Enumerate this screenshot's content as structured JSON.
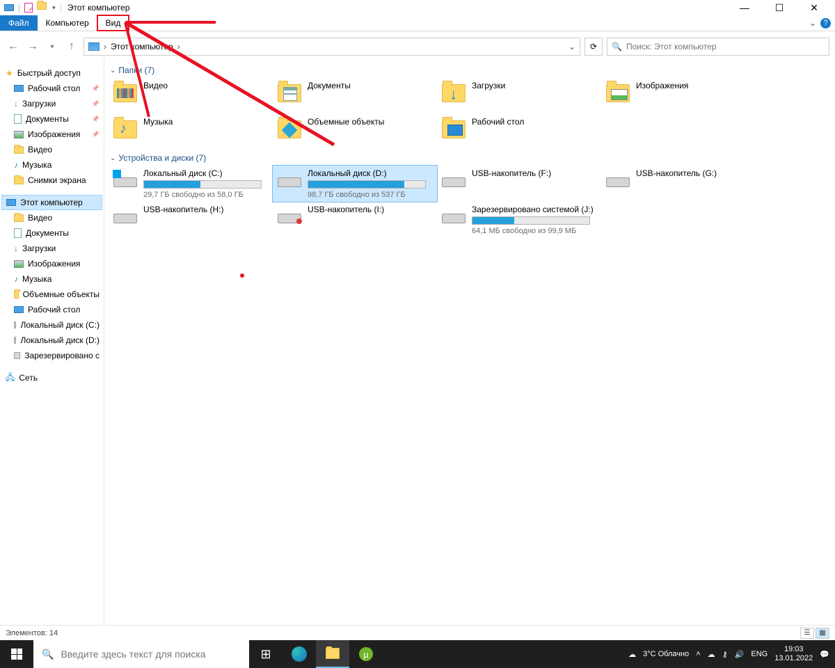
{
  "window": {
    "title": "Этот компьютер"
  },
  "ribbon": {
    "file": "Файл",
    "computer": "Компьютер",
    "view": "Вид"
  },
  "breadcrumb": {
    "label": "Этот компьютер"
  },
  "search": {
    "placeholder": "Поиск: Этот компьютер"
  },
  "sidebar": {
    "quick": "Быстрый доступ",
    "items": [
      {
        "label": "Рабочий стол"
      },
      {
        "label": "Загрузки"
      },
      {
        "label": "Документы"
      },
      {
        "label": "Изображения"
      },
      {
        "label": "Видео"
      },
      {
        "label": "Музыка"
      },
      {
        "label": "Снимки экрана"
      }
    ],
    "thispc": "Этот компьютер",
    "pc_items": [
      {
        "label": "Видео"
      },
      {
        "label": "Документы"
      },
      {
        "label": "Загрузки"
      },
      {
        "label": "Изображения"
      },
      {
        "label": "Музыка"
      },
      {
        "label": "Объемные объекты"
      },
      {
        "label": "Рабочий стол"
      },
      {
        "label": "Локальный диск (C:)"
      },
      {
        "label": "Локальный диск (D:)"
      },
      {
        "label": "Зарезервировано с"
      }
    ],
    "network": "Сеть"
  },
  "folders_header": "Папки (7)",
  "folders": [
    {
      "label": "Видео"
    },
    {
      "label": "Документы"
    },
    {
      "label": "Загрузки"
    },
    {
      "label": "Изображения"
    },
    {
      "label": "Музыка"
    },
    {
      "label": "Объемные объекты"
    },
    {
      "label": "Рабочий стол"
    }
  ],
  "drives_header": "Устройства и диски (7)",
  "drives": [
    {
      "name": "Локальный диск (C:)",
      "sub": "29,7 ГБ свободно из 58,0 ГБ",
      "fill": 48
    },
    {
      "name": "Локальный диск (D:)",
      "sub": "98,7 ГБ свободно из 537 ГБ",
      "fill": 82
    },
    {
      "name": "USB-накопитель (F:)",
      "sub": "",
      "fill": null
    },
    {
      "name": "USB-накопитель (G:)",
      "sub": "",
      "fill": null
    },
    {
      "name": "USB-накопитель (H:)",
      "sub": "",
      "fill": null
    },
    {
      "name": "USB-накопитель (I:)",
      "sub": "",
      "fill": null
    },
    {
      "name": "Зарезервировано системой (J:)",
      "sub": "64,1 МБ свободно из 99,9 МБ",
      "fill": 36
    }
  ],
  "status": {
    "count": "Элементов: 14"
  },
  "taskbar": {
    "search": "Введите здесь текст для поиска",
    "weather": "3°C  Облачно",
    "lang": "ENG",
    "time": "19:03",
    "date": "13.01.2022"
  }
}
